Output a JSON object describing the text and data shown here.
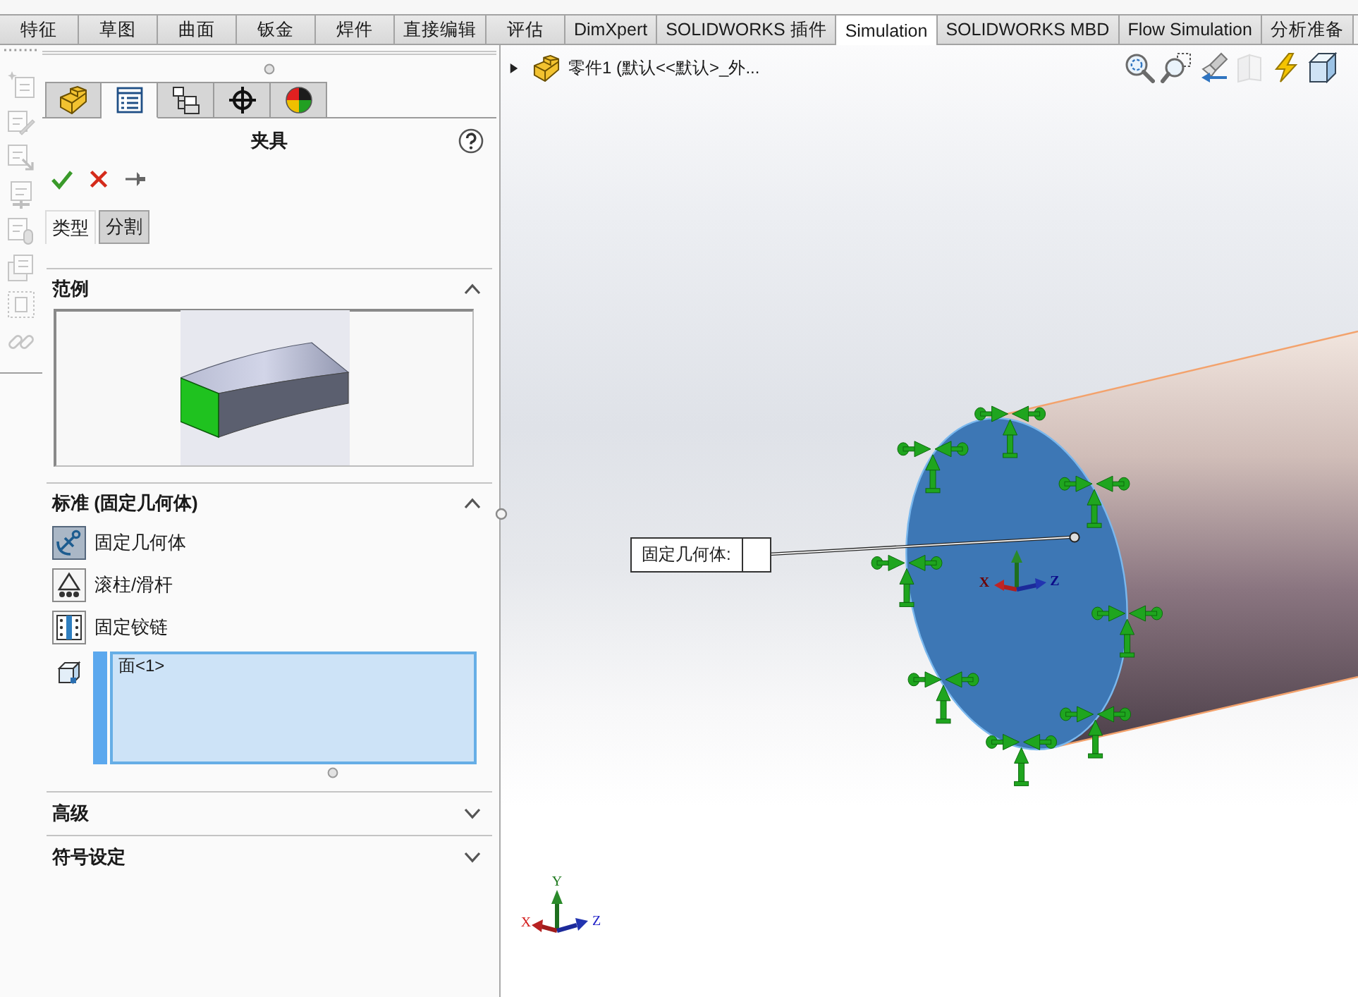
{
  "ribbon_tabs": [
    {
      "label": "特征",
      "selected": false
    },
    {
      "label": "草图",
      "selected": false
    },
    {
      "label": "曲面",
      "selected": false
    },
    {
      "label": "钣金",
      "selected": false
    },
    {
      "label": "焊件",
      "selected": false
    },
    {
      "label": "直接编辑",
      "selected": false
    },
    {
      "label": "评估",
      "selected": false
    },
    {
      "label": "DimXpert",
      "selected": false
    },
    {
      "label": "SOLIDWORKS 插件",
      "selected": false
    },
    {
      "label": "Simulation",
      "selected": true
    },
    {
      "label": "SOLIDWORKS MBD",
      "selected": false
    },
    {
      "label": "Flow Simulation",
      "selected": false
    },
    {
      "label": "分析准备",
      "selected": false
    }
  ],
  "side_tools": [
    {
      "kind": "page-star",
      "disabled": true
    },
    {
      "kind": "page-pencil",
      "disabled": true
    },
    {
      "kind": "page-arrow",
      "disabled": true
    },
    {
      "kind": "page-plus",
      "disabled": true
    },
    {
      "kind": "page-clip",
      "disabled": true
    },
    {
      "kind": "page-stack",
      "disabled": true
    },
    {
      "kind": "dotted-frame",
      "disabled": true
    },
    {
      "kind": "chain-link",
      "disabled": true
    }
  ],
  "property_manager": {
    "panel_tabs": [
      {
        "kind": "part",
        "selected": false
      },
      {
        "kind": "properties",
        "selected": true
      },
      {
        "kind": "config",
        "selected": false
      },
      {
        "kind": "target",
        "selected": false
      },
      {
        "kind": "appearance",
        "selected": false
      }
    ],
    "title": "夹具",
    "sub_tabs": [
      {
        "label": "类型",
        "selected": true
      },
      {
        "label": "分割",
        "selected": false
      }
    ],
    "sections": [
      {
        "kind": "example",
        "title": "范例",
        "expanded": true
      },
      {
        "kind": "standard",
        "title": "标准 (固定几何体)",
        "expanded": true,
        "options": [
          {
            "kind": "fixed",
            "label": "固定几何体",
            "selected": true
          },
          {
            "kind": "roller",
            "label": "滚柱/滑杆",
            "selected": false
          },
          {
            "kind": "hinge",
            "label": "固定铰链",
            "selected": false
          }
        ],
        "selection": {
          "active": true,
          "items": [
            "面<1>"
          ]
        }
      },
      {
        "kind": "advanced",
        "title": "高级",
        "expanded": false
      },
      {
        "kind": "symbols",
        "title": "符号设定",
        "expanded": false
      }
    ]
  },
  "graphics_view": {
    "tree_item": {
      "label": "零件1 (默认<<默认>_外...",
      "expanded": false
    },
    "view_tools": [
      {
        "kind": "zoom-fit",
        "disabled": false
      },
      {
        "kind": "zoom-area",
        "disabled": false
      },
      {
        "kind": "previous-view",
        "disabled": false
      },
      {
        "kind": "section-view",
        "disabled": true
      },
      {
        "kind": "display",
        "disabled": false
      },
      {
        "kind": "view-cube",
        "disabled": false
      }
    ],
    "callout": {
      "label": "固定几何体:"
    },
    "face_triad": {
      "x_label": "X",
      "z_label": "Z"
    },
    "axis_triad": {
      "x_label": "X",
      "y_label": "Y",
      "z_label": "Z"
    }
  }
}
